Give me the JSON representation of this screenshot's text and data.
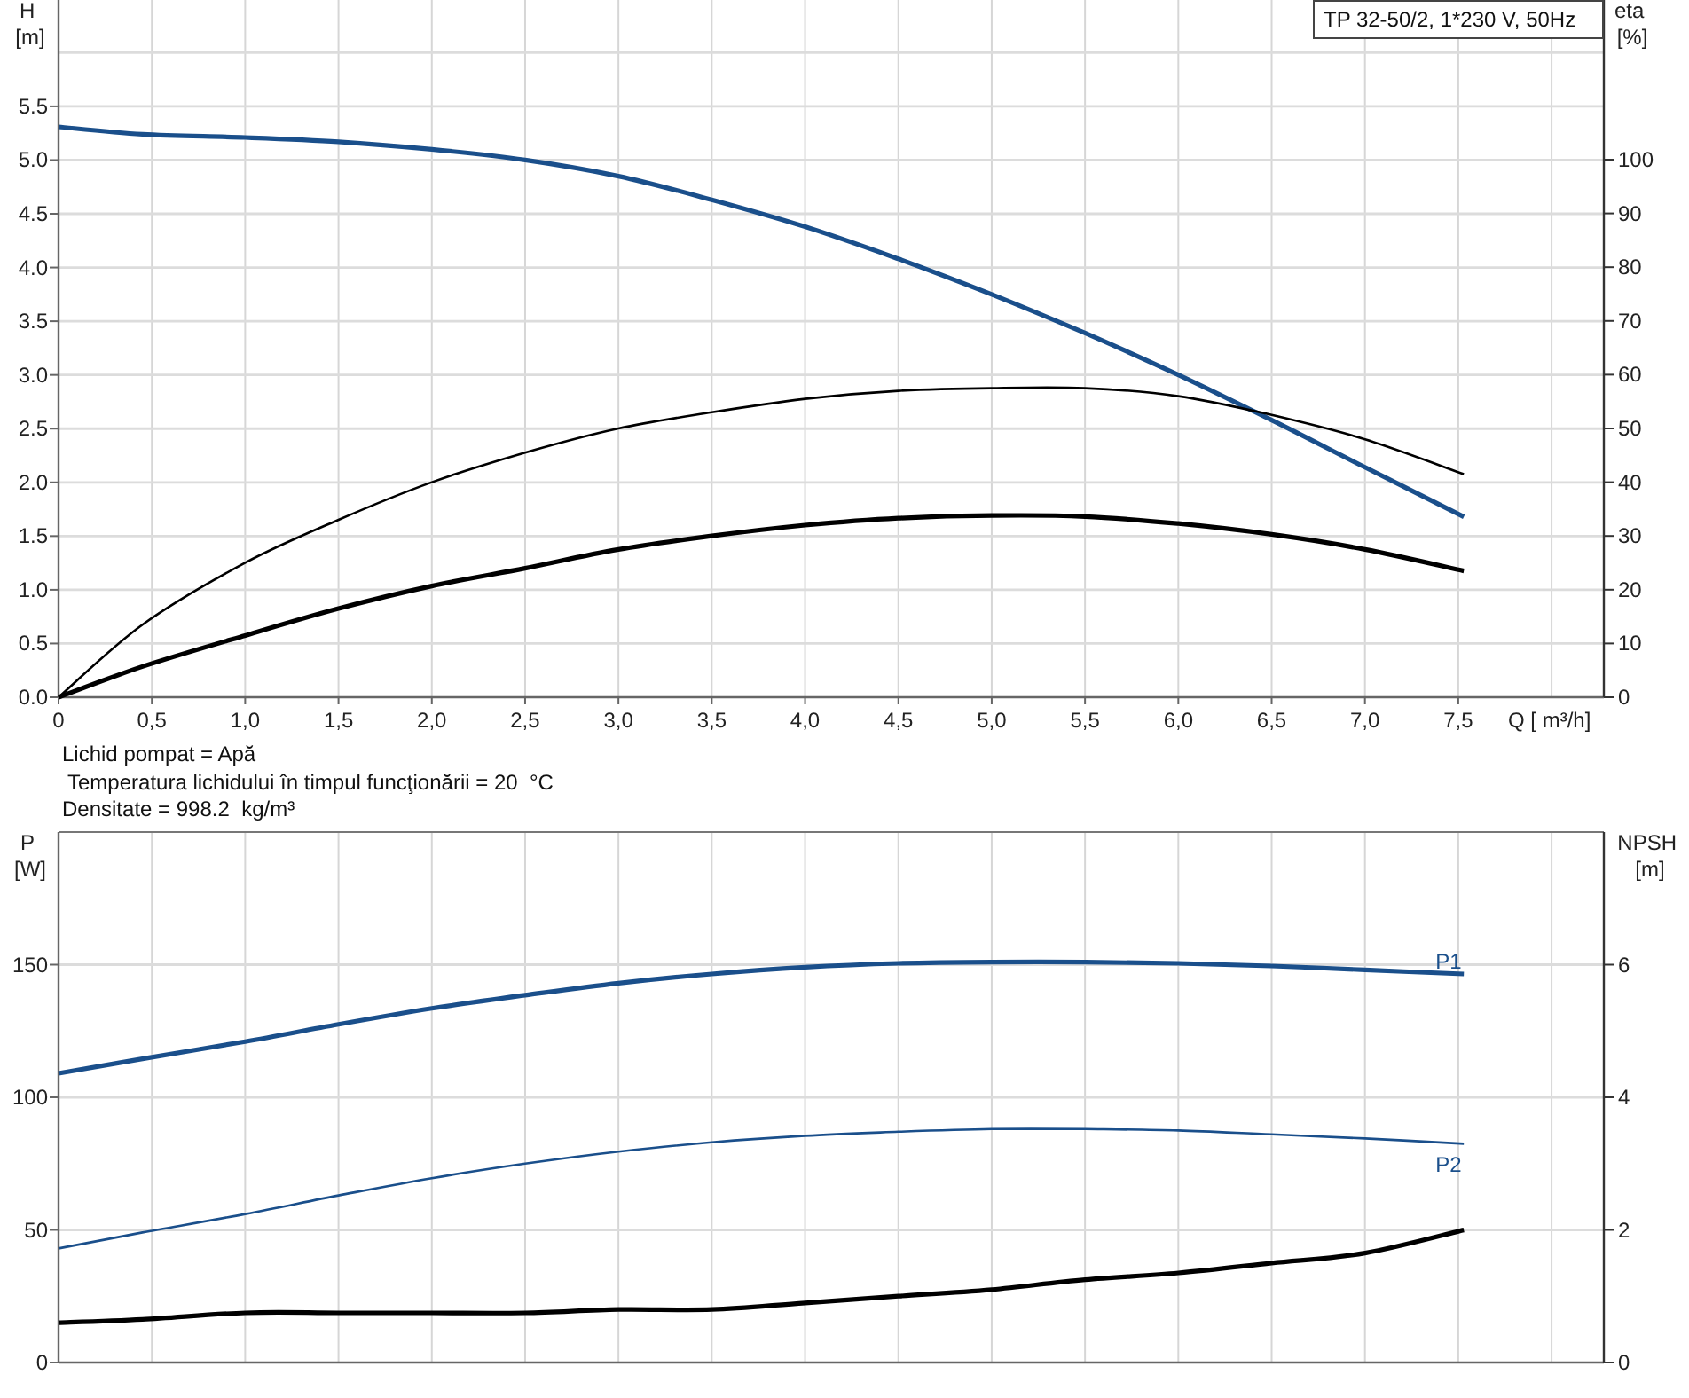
{
  "head_chart": {
    "chart_data": {
      "type": "line",
      "grid": true,
      "title": "TP 32-50/2, 1*230 V, 50Hz",
      "xlabel": "Q [ m³/h]",
      "ylabel": "H [m]",
      "y2label": "eta [%]",
      "xlim": [
        0,
        8.28
      ],
      "ylim": [
        0,
        6.49
      ],
      "y2lim": [
        0,
        129.7
      ],
      "xticks": [
        {
          "value": 0,
          "label": "0"
        },
        {
          "value": 0.5,
          "label": "0,5"
        },
        {
          "value": 1,
          "label": "1,0"
        },
        {
          "value": 1.5,
          "label": "1,5"
        },
        {
          "value": 2,
          "label": "2,0"
        },
        {
          "value": 2.5,
          "label": "2,5"
        },
        {
          "value": 3,
          "label": "3,0"
        },
        {
          "value": 3.5,
          "label": "3,5"
        },
        {
          "value": 4,
          "label": "4,0"
        },
        {
          "value": 4.5,
          "label": "4,5"
        },
        {
          "value": 5,
          "label": "5,0"
        },
        {
          "value": 5.5,
          "label": "5,5"
        },
        {
          "value": 6,
          "label": "6,0"
        },
        {
          "value": 6.5,
          "label": "6,5"
        },
        {
          "value": 7,
          "label": "7,0"
        },
        {
          "value": 7.5,
          "label": "7,5"
        }
      ],
      "yticks": [
        {
          "value": 0,
          "label": "0.0"
        },
        {
          "value": 0.5,
          "label": "0.5"
        },
        {
          "value": 1,
          "label": "1.0"
        },
        {
          "value": 1.5,
          "label": "1.5"
        },
        {
          "value": 2,
          "label": "2.0"
        },
        {
          "value": 2.5,
          "label": "2.5"
        },
        {
          "value": 3,
          "label": "3.0"
        },
        {
          "value": 3.5,
          "label": "3.5"
        },
        {
          "value": 4,
          "label": "4.0"
        },
        {
          "value": 4.5,
          "label": "4.5"
        },
        {
          "value": 5,
          "label": "5.0"
        },
        {
          "value": 5.5,
          "label": "5.5"
        }
      ],
      "y2ticks": [
        0,
        10,
        20,
        30,
        40,
        50,
        60,
        70,
        80,
        90,
        100
      ],
      "x": [
        0,
        0.45,
        1,
        1.5,
        2,
        2.5,
        3,
        3.5,
        4,
        4.5,
        5,
        5.5,
        6,
        6.5,
        7,
        7.53
      ],
      "series": [
        {
          "axis": "y",
          "color": "#1a4f8b",
          "values": [
            5.31,
            5.24,
            5.21,
            5.17,
            5.1,
            5.0,
            4.85,
            4.63,
            4.38,
            4.08,
            3.75,
            3.39,
            3.0,
            2.58,
            2.14,
            1.68
          ]
        },
        {
          "axis": "y2",
          "color": "#000000",
          "values": [
            0,
            13.5,
            25,
            33,
            40,
            45.5,
            50,
            53,
            55.5,
            57,
            57.5,
            57.5,
            56,
            52.5,
            48,
            41.5
          ]
        },
        {
          "axis": "y2",
          "color": "#000000",
          "values": [
            0,
            5.7,
            11.5,
            16.5,
            20.7,
            24,
            27.5,
            30,
            32,
            33.3,
            33.8,
            33.6,
            32.3,
            30.3,
            27.5,
            23.5
          ]
        }
      ]
    }
  },
  "liquid_info": [
    "Lichid pompat = Apă",
    "Temperatura lichidului în timpul funcţionării = 20  °C",
    "Densitate = 998.2  kg/m³"
  ],
  "power_chart": {
    "chart_data": {
      "type": "line",
      "grid": true,
      "ylabel": "P [W]",
      "y2label": "NPSH [m]",
      "xlim": [
        0,
        8.28
      ],
      "ylim": [
        0,
        200
      ],
      "y2lim": [
        0,
        8
      ],
      "yticks": [
        {
          "value": 0,
          "label": "0"
        },
        {
          "value": 50,
          "label": "50"
        },
        {
          "value": 100,
          "label": "100"
        },
        {
          "value": 150,
          "label": "150"
        }
      ],
      "y2ticks": [
        0,
        2,
        4,
        6
      ],
      "x": [
        0,
        0.45,
        1,
        1.5,
        2,
        2.5,
        3,
        3.5,
        4,
        4.5,
        5,
        5.5,
        6,
        6.5,
        7,
        7.53
      ],
      "series": [
        {
          "name": "P1",
          "axis": "y",
          "color": "#1a4f8b",
          "values": [
            109,
            114.5,
            121,
            127.5,
            133.5,
            138.5,
            143,
            146.5,
            149,
            150.5,
            151,
            151,
            150.5,
            149.5,
            148,
            146.5
          ]
        },
        {
          "name": "P2",
          "axis": "y",
          "color": "#1a4f8b",
          "values": [
            43,
            49,
            56,
            63,
            69.5,
            75,
            79.5,
            83,
            85.5,
            87,
            88,
            88,
            87.5,
            86,
            84.5,
            82.5
          ]
        },
        {
          "axis": "y2",
          "color": "#000000",
          "values": [
            0.6,
            0.65,
            0.75,
            0.75,
            0.75,
            0.75,
            0.8,
            0.8,
            0.9,
            1.0,
            1.1,
            1.25,
            1.35,
            1.5,
            1.65,
            2.0
          ]
        }
      ]
    }
  }
}
